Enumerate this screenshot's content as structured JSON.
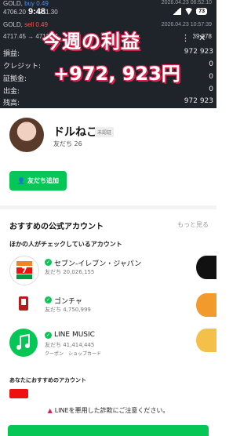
{
  "status": {
    "time": "9:48",
    "battery": "73"
  },
  "trading": {
    "rows": [
      {
        "symbol": "GOLD,",
        "side": "buy 0.49",
        "price": "4706.20 → 4711.30",
        "time": "2026.04.23 06:52:10",
        "pnl": ""
      },
      {
        "symbol": "GOLD,",
        "side": "sell 0.49",
        "price": "4717.45 → 4711.39",
        "time": "2026.04.23 10:57:39",
        "pnl": "39 978"
      }
    ],
    "account": [
      {
        "label": "損益:",
        "value": "972 923"
      },
      {
        "label": "クレジット:",
        "value": "0"
      },
      {
        "label": "証拠金:",
        "value": "0"
      },
      {
        "label": "出金:",
        "value": "0"
      },
      {
        "label": "残高:",
        "value": "972 923"
      }
    ],
    "overlay_title": "今週の利益",
    "overlay_amount": "+972, 923円"
  },
  "profile": {
    "name": "ドルねこ",
    "badge": "未認証",
    "friends": "友だち 26",
    "add_button": "友だち追加"
  },
  "recommended": {
    "title": "おすすめの公式アカウント",
    "more": "もっと見る",
    "subtitle": "ほかの人がチェックしているアカウント",
    "items": [
      {
        "name": "セブン-イレブン・ジャパン",
        "count": "友だち 20,026,155",
        "tags": [],
        "logo": "7eleven-logo"
      },
      {
        "name": "ゴンチャ",
        "count": "友だち 4,750,999",
        "tags": [],
        "logo": "gongcha-logo"
      },
      {
        "name": "LINE MUSIC",
        "count": "友だち 41,414,445",
        "tags": [
          "クーポン",
          "ショップカード"
        ],
        "logo": "linemusic-logo"
      }
    ],
    "subtitle2": "あなたにおすすめのアカウント"
  },
  "warning": "LINEを悪用した詐欺にご注意ください。"
}
